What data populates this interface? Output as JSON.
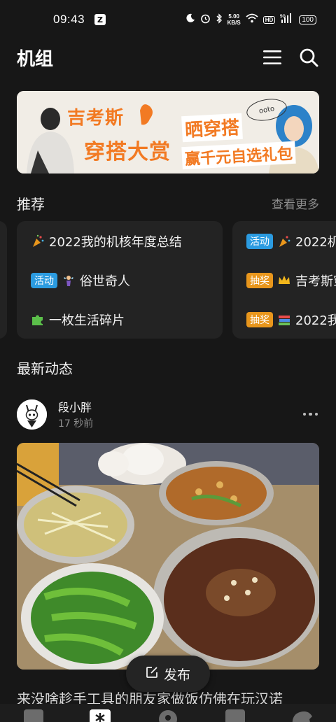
{
  "status_bar": {
    "time": "09:43",
    "app_icon": "Z",
    "net_speed_value": "5.00",
    "net_speed_unit": "KB/S",
    "hd": "HD",
    "signal": "5G",
    "battery": "100"
  },
  "header": {
    "title": "机组",
    "icons": [
      "menu-icon",
      "search-icon"
    ]
  },
  "banner": {
    "line1": "吉考斯",
    "line2": "穿搭大赏",
    "line3": "晒穿搭",
    "line4": "赢千元自选礼包",
    "brand": "ooto",
    "colors": {
      "accent": "#f27a23",
      "background": "#f1ede6"
    }
  },
  "recommend": {
    "title": "推荐",
    "more": "查看更多",
    "cards": [
      {
        "items": [
          {
            "tag": "",
            "emoji": "confetti-icon",
            "text": "2022我的机核年度总结"
          },
          {
            "tag": "活动",
            "tag_color": "#2b9be0",
            "emoji": "fairy-icon",
            "text": "俗世奇人"
          },
          {
            "tag": "",
            "emoji": "puzzle-icon",
            "text": "一枚生活碎片"
          }
        ]
      },
      {
        "items": [
          {
            "tag": "活动",
            "tag_color": "#2b9be0",
            "emoji": "confetti-icon",
            "text": "2022机"
          },
          {
            "tag": "抽奖",
            "tag_color": "#e8961c",
            "emoji": "crown-icon",
            "text": "吉考斯穿"
          },
          {
            "tag": "抽奖",
            "tag_color": "#e8961c",
            "emoji": "books-icon",
            "text": "2022我"
          }
        ]
      }
    ]
  },
  "latest": {
    "title": "最新动态",
    "post": {
      "user": "段小胖",
      "time": "17 秒前",
      "text": "来没啥趁手工具的朋友家做饭仿佛在玩汉诺"
    }
  },
  "publish": {
    "label": "发布"
  },
  "bottom_nav": {
    "icons": [
      "calendar-icon",
      "asterisk-icon",
      "radio-icon",
      "cup-icon",
      "dinosaur-icon"
    ]
  }
}
